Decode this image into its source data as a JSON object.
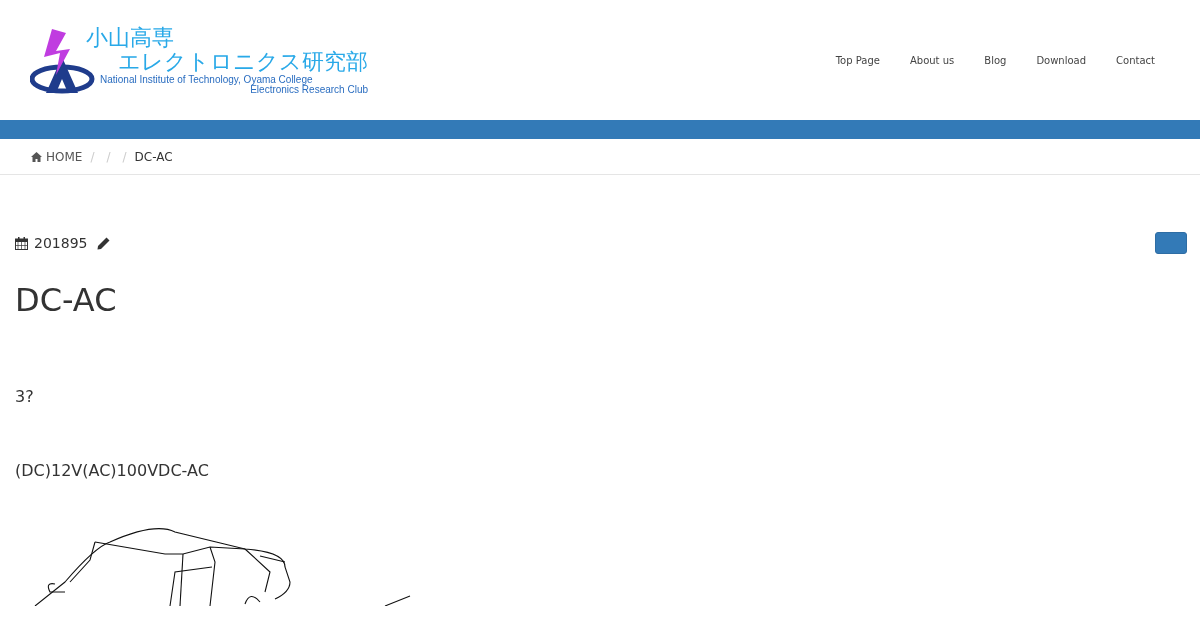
{
  "logo": {
    "title_line_1": "小山高専",
    "title_line_2": "エレクトロニクス研究部",
    "subtitle_line_1": "National Institute of Technology, Oyama College",
    "subtitle_line_2": "Electronics Research Club"
  },
  "nav": [
    "Top Page",
    "About us",
    "Blog",
    "Download",
    "Contact"
  ],
  "breadcrumb": {
    "home": "HOME",
    "separators": [
      "/",
      "/",
      "/"
    ],
    "current": "DC-AC"
  },
  "post": {
    "date": "201895",
    "title": "DC-AC",
    "paragraphs": [
      "3?",
      "(DC)12V(AC)100VDC-AC"
    ]
  }
}
